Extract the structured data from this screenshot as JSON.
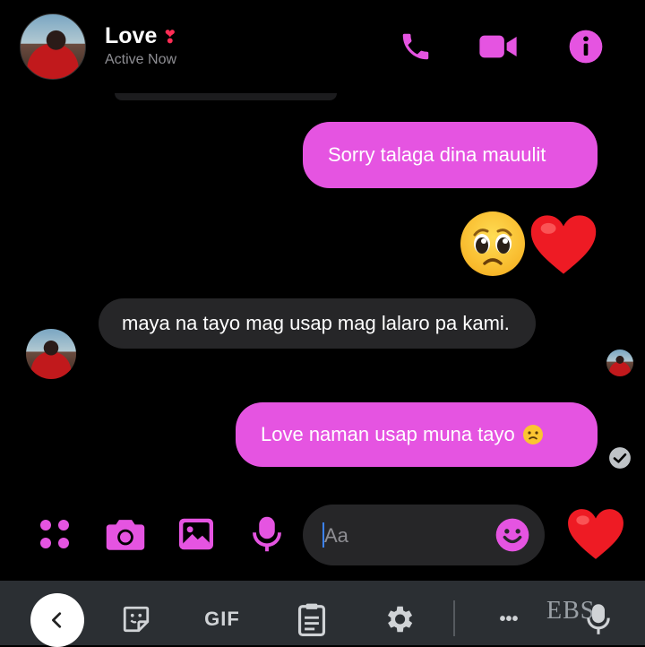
{
  "header": {
    "contact_name": "Love",
    "name_emoji": "❣",
    "status": "Active Now",
    "icons": [
      "phone-icon",
      "video-call-icon",
      "info-icon"
    ]
  },
  "messages": {
    "m1": "Sorry talaga dina mauulit",
    "m2_emojis": [
      "pleading-face-emoji",
      "red-heart-emoji"
    ],
    "m3": "maya na tayo mag usap mag lalaro pa kami.",
    "m4_text": "Love naman usap muna tayo",
    "m4_emoji": "sad-face-emoji"
  },
  "composer": {
    "placeholder": "Aa",
    "icons": [
      "apps-icon",
      "camera-icon",
      "gallery-icon",
      "mic-icon",
      "emoji-icon",
      "like-heart-icon"
    ]
  },
  "keyboard_toolbar": {
    "gif_label": "GIF",
    "more_label": "•••",
    "watermark": "EBS",
    "icons": [
      "back-chevron-icon",
      "sticker-icon",
      "clipboard-icon",
      "settings-icon",
      "voice-mic-icon"
    ]
  },
  "colors": {
    "accent": "#e554e1",
    "background": "#000000",
    "incoming_bubble": "#262628",
    "heart": "#ee1b24",
    "keyboard_bar": "#2b2f33"
  }
}
